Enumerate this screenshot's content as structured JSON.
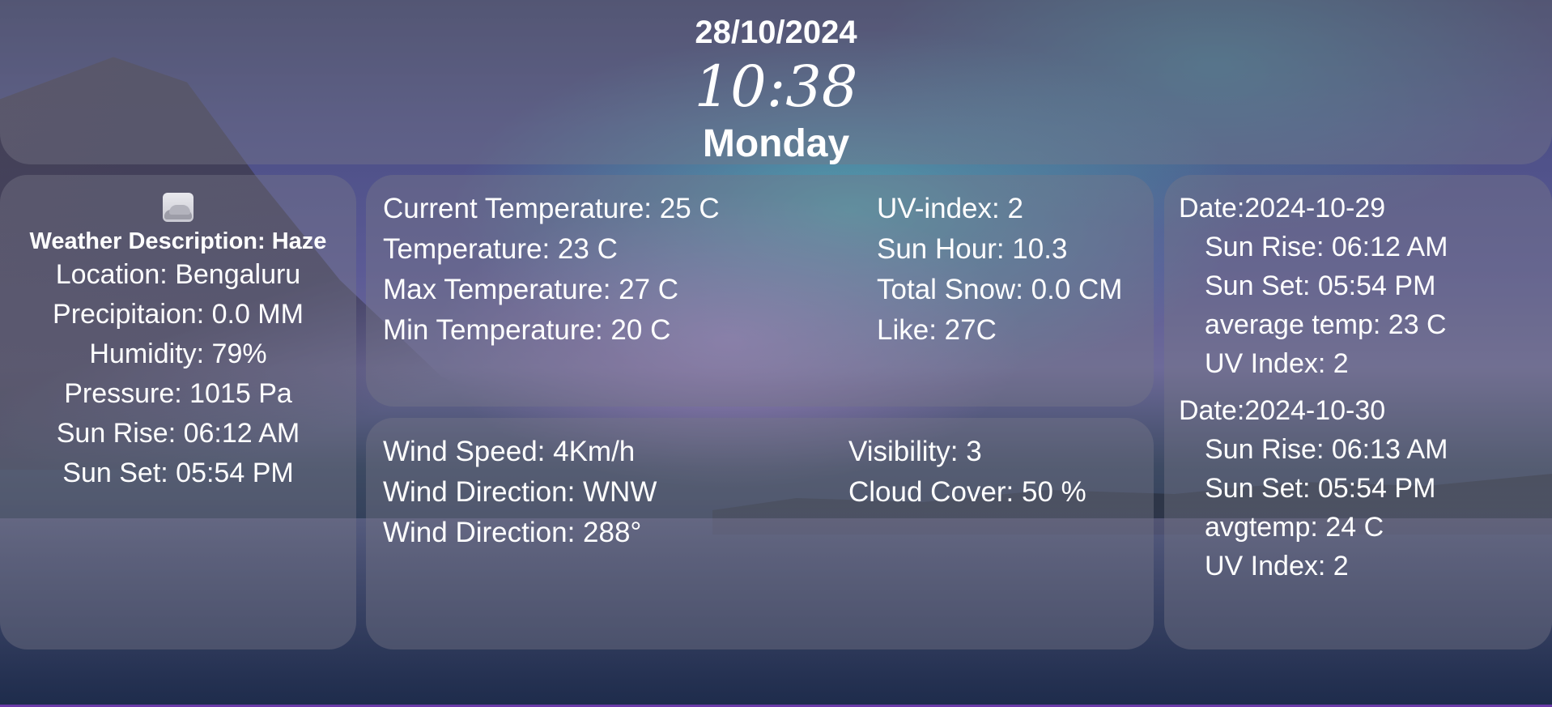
{
  "header": {
    "date": "28/10/2024",
    "time": "10:38",
    "day": "Monday"
  },
  "current": {
    "icon": "haze-icon",
    "description": "Weather Description: Haze",
    "lines": [
      "Location: Bengaluru",
      "Precipitaion: 0.0 MM",
      "Humidity: 79%",
      "Pressure: 1015 Pa",
      "Sun Rise: 06:12 AM",
      "Sun Set: 05:54 PM"
    ]
  },
  "temperature": {
    "current": "Current Temperature: 25 C",
    "temp": "Temperature: 23 C",
    "max": "Max Temperature: 27 C",
    "min": "Min Temperature: 20 C",
    "uv": "UV-index: 2",
    "sun_hour": "Sun Hour: 10.3",
    "snow": "Total Snow: 0.0 CM",
    "like": "Like: 27C"
  },
  "wind": {
    "speed": "Wind Speed: 4Km/h",
    "direction": "Wind Direction: WNW",
    "degree": "Wind Direction: 288°",
    "visibility": "Visibility: 3",
    "cloud": "Cloud Cover: 50 %"
  },
  "forecast": [
    {
      "date": "Date:2024-10-29",
      "sunrise": "Sun Rise: 06:12 AM",
      "sunset": "Sun Set: 05:54 PM",
      "avg": "average temp: 23 C",
      "uv": "UV Index: 2"
    },
    {
      "date": "Date:2024-10-30",
      "sunrise": "Sun Rise: 06:13 AM",
      "sunset": "Sun Set: 05:54 PM",
      "avg": "avgtemp: 24 C",
      "uv": "UV Index: 2"
    }
  ]
}
